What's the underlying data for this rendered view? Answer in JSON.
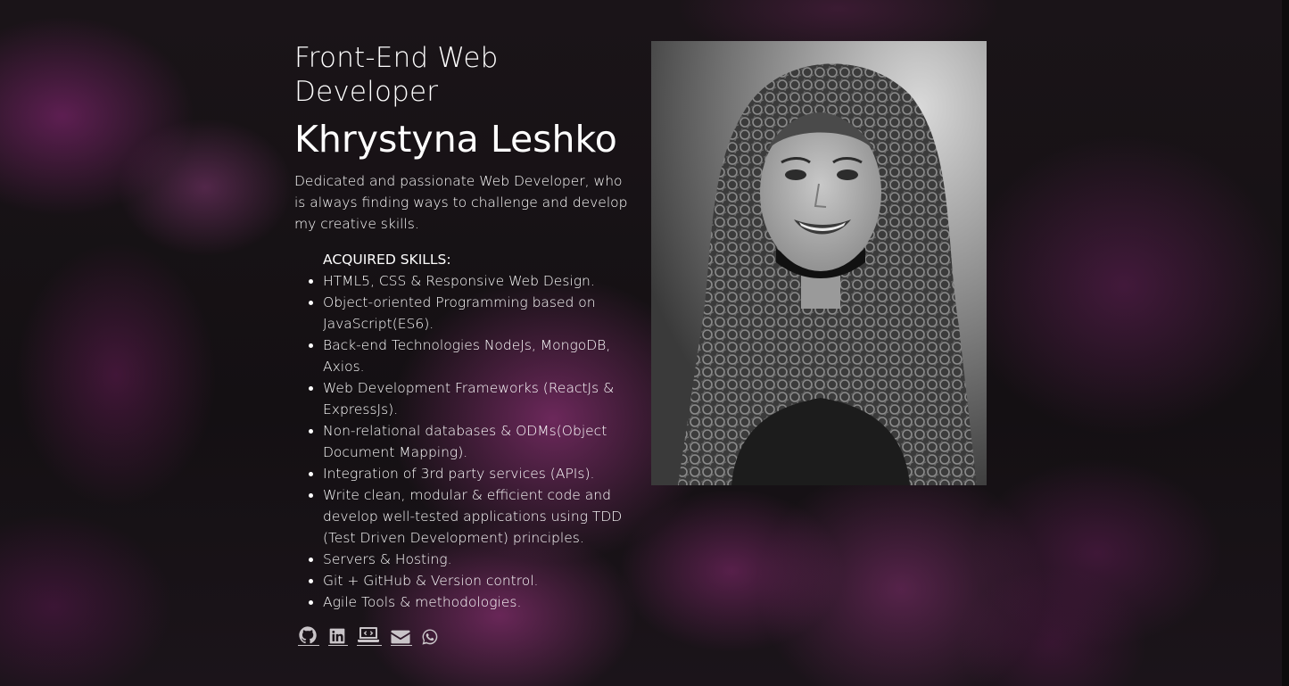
{
  "header": {
    "subtitle": "Front-End Web Developer",
    "name": "Khrystyna Leshko"
  },
  "bio": "Dedicated and passionate Web Developer, who is always finding ways to challenge and develop my creative skills.",
  "skills": {
    "heading": "ACQUIRED SKILLS:",
    "items": [
      "HTML5, CSS & Responsive Web Design.",
      "Object-oriented Programming based on JavaScript(ES6).",
      "Back-end Technologies NodeJs, MongoDB, Axios.",
      "Web Development Frameworks (ReactJs & ExpressJs).",
      "Non-relational databases & ODMs(Object Document Mapping).",
      "Integration of 3rd party services (APIs).",
      "Write clean, modular & efficient code and develop well-tested applications using TDD (Test Driven Development) principles.",
      "Servers & Hosting.",
      "Git + GitHub & Version control.",
      "Agile Tools & methodologies."
    ]
  },
  "social": [
    {
      "icon": "github-icon"
    },
    {
      "icon": "linkedin-icon"
    },
    {
      "icon": "portfolio-laptop-icon"
    },
    {
      "icon": "envelope-icon"
    },
    {
      "icon": "whatsapp-icon"
    }
  ],
  "colors": {
    "text": "#ffffff",
    "icon": "#c9c4c8",
    "background_base": "#161214",
    "flower_accent": "#a8388f"
  }
}
